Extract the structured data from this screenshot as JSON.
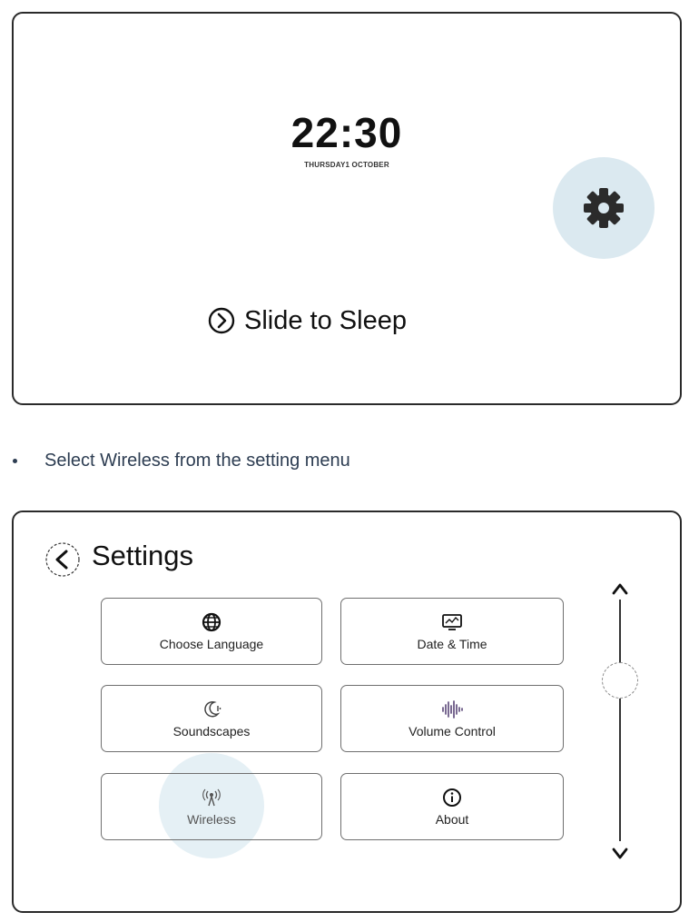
{
  "home": {
    "time": "22:30",
    "date": "THURSDAY1 OCTOBER",
    "slide_label": "Slide to Sleep",
    "settings_icon": "gear-icon",
    "accent": "#dbe9f0"
  },
  "instruction": {
    "text": "Select Wireless from the setting menu"
  },
  "settings": {
    "title": "Settings",
    "back_icon": "chevron-left-icon",
    "tiles": [
      {
        "label": "Choose Language",
        "icon": "globe-icon"
      },
      {
        "label": "Date & Time",
        "icon": "monitor-icon"
      },
      {
        "label": "Soundscapes",
        "icon": "moon-sound-icon"
      },
      {
        "label": "Volume Control",
        "icon": "waveform-icon"
      },
      {
        "label": "Wireless",
        "icon": "antenna-icon"
      },
      {
        "label": "About",
        "icon": "info-icon"
      }
    ],
    "highlighted_tile": "Wireless",
    "scroll": {
      "up_icon": "chevron-up-icon",
      "down_icon": "chevron-down-icon"
    }
  }
}
